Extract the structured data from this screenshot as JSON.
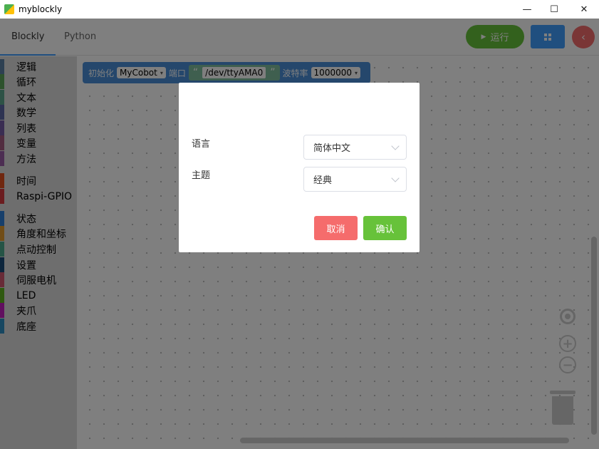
{
  "window": {
    "title": "myblockly",
    "minimize": "—",
    "maximize": "☐",
    "close": "✕"
  },
  "tabs": {
    "blockly": "Blockly",
    "python": "Python"
  },
  "toolbar": {
    "run_label": "运行",
    "run_icon": "▶",
    "back_icon": "‹"
  },
  "toolbox": {
    "groups": [
      [
        {
          "label": "逻辑",
          "color": "#5b80a5"
        },
        {
          "label": "循环",
          "color": "#5ba55b"
        },
        {
          "label": "文本",
          "color": "#5ba58c"
        },
        {
          "label": "数学",
          "color": "#5b67a5"
        },
        {
          "label": "列表",
          "color": "#745ba5"
        },
        {
          "label": "变量",
          "color": "#a55b80"
        },
        {
          "label": "方法",
          "color": "#995ba5"
        }
      ],
      [
        {
          "label": "时间",
          "color": "#e04e1f"
        },
        {
          "label": "Raspi-GPIO",
          "color": "#d7383f"
        }
      ],
      [
        {
          "label": "状态",
          "color": "#2f7fd6"
        },
        {
          "label": "角度和坐标",
          "color": "#e39a2f"
        },
        {
          "label": "点动控制",
          "color": "#4aa88c"
        },
        {
          "label": "设置",
          "color": "#194a78"
        },
        {
          "label": "伺服电机",
          "color": "#d1566f"
        },
        {
          "label": "LED",
          "color": "#5fb321"
        },
        {
          "label": "夹爪",
          "color": "#c21fbf"
        },
        {
          "label": "底座",
          "color": "#2f8fc2"
        }
      ]
    ]
  },
  "block": {
    "init_label": "初始化",
    "robot": "MyCobot",
    "port_label": "端口",
    "port_value": "/dev/ttyAMA0",
    "open_quote": "“",
    "close_quote": "”",
    "baud_label": "波特率",
    "baud_value": "1000000",
    "dropdown_icon": "▾"
  },
  "dialog": {
    "language_label": "语言",
    "language_value": "简体中文",
    "theme_label": "主题",
    "theme_value": "经典",
    "cancel": "取消",
    "confirm": "确认"
  },
  "workspace": {
    "zoom_in": "+",
    "zoom_out": "−"
  }
}
